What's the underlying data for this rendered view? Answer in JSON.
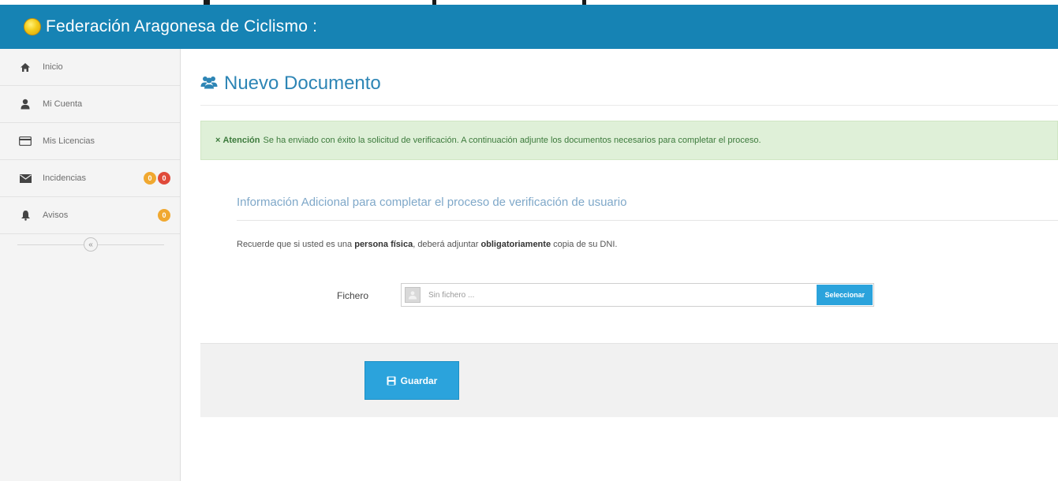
{
  "header": {
    "title": "Federación Aragonesa de Ciclismo :"
  },
  "sidebar": {
    "items": [
      {
        "label": "Inicio",
        "icon": "home-icon"
      },
      {
        "label": "Mi Cuenta",
        "icon": "user-icon"
      },
      {
        "label": "Mis Licencias",
        "icon": "card-icon"
      },
      {
        "label": "Incidencias",
        "icon": "envelope-icon",
        "badges": [
          "0",
          "0"
        ]
      },
      {
        "label": "Avisos",
        "icon": "bell-icon",
        "badges": [
          "0"
        ]
      }
    ],
    "collapse_label": "«"
  },
  "main": {
    "page_title": "Nuevo Documento",
    "alert": {
      "icon": "×",
      "strong": "Atención",
      "text": "Se ha enviado con éxito la solicitud de verificación. A continuación adjunte los documentos necesarios para completar el proceso."
    },
    "section_title": "Información Adicional para completar el proceso de verificación de usuario",
    "note": {
      "part1": "Recuerde que si usted es una ",
      "bold1": "persona física",
      "part2": ", deberá adjuntar ",
      "bold2": "obligatoriamente",
      "part3": " copia de su DNI."
    },
    "file": {
      "label": "Fichero",
      "placeholder": "Sin fichero ...",
      "select_label": "Seleccionar"
    },
    "save_label": "Guardar"
  },
  "colors": {
    "header": "#1683b4",
    "accent": "#2ba3dc",
    "alert_bg": "#dff0d8",
    "badge_orange": "#f0a830",
    "badge_red": "#e04a3a"
  }
}
